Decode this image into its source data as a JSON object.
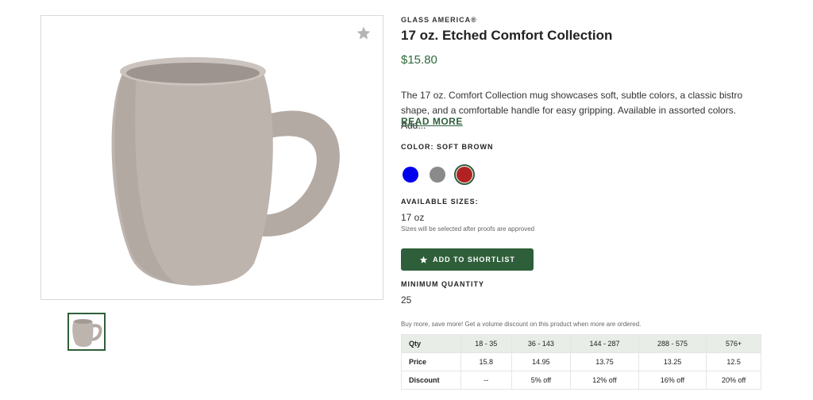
{
  "product": {
    "brand": "GLASS AMERICA®",
    "title": "17 oz. Etched Comfort Collection",
    "price": "$15.80",
    "description": "The 17 oz. Comfort Collection mug showcases soft, subtle colors, a classic bistro shape, and a comfortable handle for easy gripping. Available in assorted colors. Add...",
    "read_more": "READ MORE"
  },
  "color": {
    "label": "COLOR: SOFT BROWN",
    "swatches": [
      {
        "name": "blue",
        "hex": "#0000ee"
      },
      {
        "name": "gray",
        "hex": "#8a8a8a"
      },
      {
        "name": "red",
        "hex": "#b22222"
      }
    ],
    "selected_index": 2
  },
  "sizes": {
    "label": "AVAILABLE SIZES:",
    "value": "17 oz",
    "note": "Sizes will be selected after proofs are approved"
  },
  "shortlist": {
    "label": "ADD TO SHORTLIST",
    "icon": "star-icon"
  },
  "minimum": {
    "label": "MINIMUM QUANTITY",
    "value": "25"
  },
  "volume_note": "Buy more, save more! Get a volume discount on this product when more are ordered.",
  "pricing_table": {
    "header": [
      "Qty",
      "18 - 35",
      "36 - 143",
      "144 - 287",
      "288 - 575",
      "576+"
    ],
    "rows": [
      [
        "Price",
        "15.8",
        "14.95",
        "13.75",
        "13.25",
        "12.5"
      ],
      [
        "Discount",
        "--",
        "5% off",
        "12% off",
        "16% off",
        "20% off"
      ]
    ]
  },
  "colors": {
    "accent": "#2e5f3a",
    "price": "#2e6b3a",
    "mug": "#b9b0aa"
  }
}
